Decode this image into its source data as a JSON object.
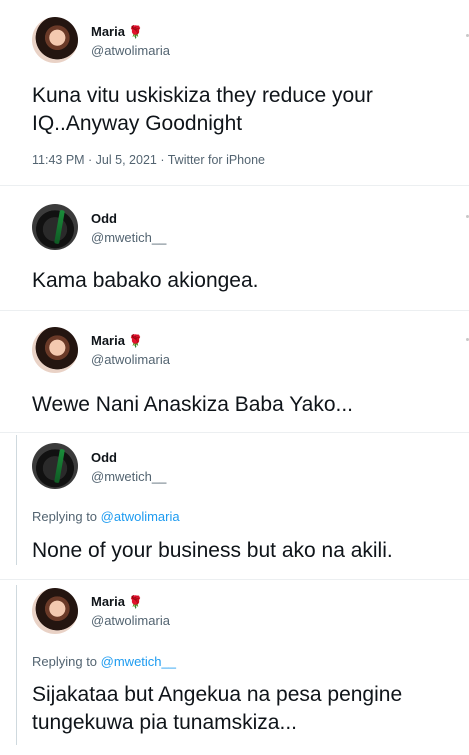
{
  "tweets": [
    {
      "name": "Maria",
      "emoji": "🌹",
      "handle": "@atwolimaria",
      "text": "Kuna vitu uskiskiza they reduce your IQ..Anyway Goodnight",
      "meta": "11:43 PM · Jul 5, 2021 · Twitter for iPhone"
    },
    {
      "name": "Odd",
      "handle": "@mwetich__",
      "text": "Kama babako akiongea."
    },
    {
      "name": "Maria",
      "emoji": "🌹",
      "handle": "@atwolimaria",
      "text": "Wewe Nani Anaskiza Baba Yako..."
    },
    {
      "name": "Odd",
      "handle": "@mwetich__",
      "replying_prefix": "Replying to ",
      "replying_to": "@atwolimaria",
      "text": "None of your business but ako na akili."
    },
    {
      "name": "Maria",
      "emoji": "🌹",
      "handle": "@atwolimaria",
      "replying_prefix": "Replying to ",
      "replying_to": "@mwetich__",
      "text_line1": "Sijakataa but Angekua na pesa pengine",
      "text_line2": "tungekuwa pia tunamskiza..."
    }
  ]
}
